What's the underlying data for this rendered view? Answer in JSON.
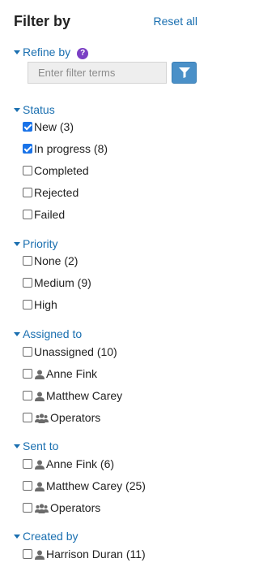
{
  "header": {
    "title": "Filter by",
    "reset_label": "Reset all"
  },
  "refine": {
    "label": "Refine by",
    "help_glyph": "?",
    "placeholder": "Enter filter terms",
    "value": ""
  },
  "sections": {
    "status": {
      "label": "Status",
      "items": [
        {
          "label": "New (3)",
          "checked": true
        },
        {
          "label": "In progress (8)",
          "checked": true
        },
        {
          "label": "Completed",
          "checked": false
        },
        {
          "label": "Rejected",
          "checked": false
        },
        {
          "label": "Failed",
          "checked": false
        }
      ]
    },
    "priority": {
      "label": "Priority",
      "items": [
        {
          "label": "None (2)",
          "checked": false
        },
        {
          "label": "Medium (9)",
          "checked": false
        },
        {
          "label": "High",
          "checked": false
        }
      ]
    },
    "assigned": {
      "label": "Assigned to",
      "items": [
        {
          "label": "Unassigned (10)",
          "checked": false,
          "icon": ""
        },
        {
          "label": "Anne Fink",
          "checked": false,
          "icon": "user-icon"
        },
        {
          "label": "Matthew Carey",
          "checked": false,
          "icon": "user-icon"
        },
        {
          "label": "Operators",
          "checked": false,
          "icon": "group-icon"
        }
      ]
    },
    "sent": {
      "label": "Sent to",
      "items": [
        {
          "label": "Anne Fink (6)",
          "checked": false,
          "icon": "user-icon"
        },
        {
          "label": "Matthew Carey (25)",
          "checked": false,
          "icon": "user-icon"
        },
        {
          "label": "Operators",
          "checked": false,
          "icon": "group-icon"
        }
      ]
    },
    "created": {
      "label": "Created by",
      "items": [
        {
          "label": "Harrison Duran (11)",
          "checked": false,
          "icon": "user-icon"
        }
      ]
    }
  },
  "colors": {
    "accent": "#1a6fb0",
    "help": "#7b3fc4",
    "button": "#4a90c8",
    "checked": "#1a73e8",
    "icon": "#6b6b6b"
  }
}
